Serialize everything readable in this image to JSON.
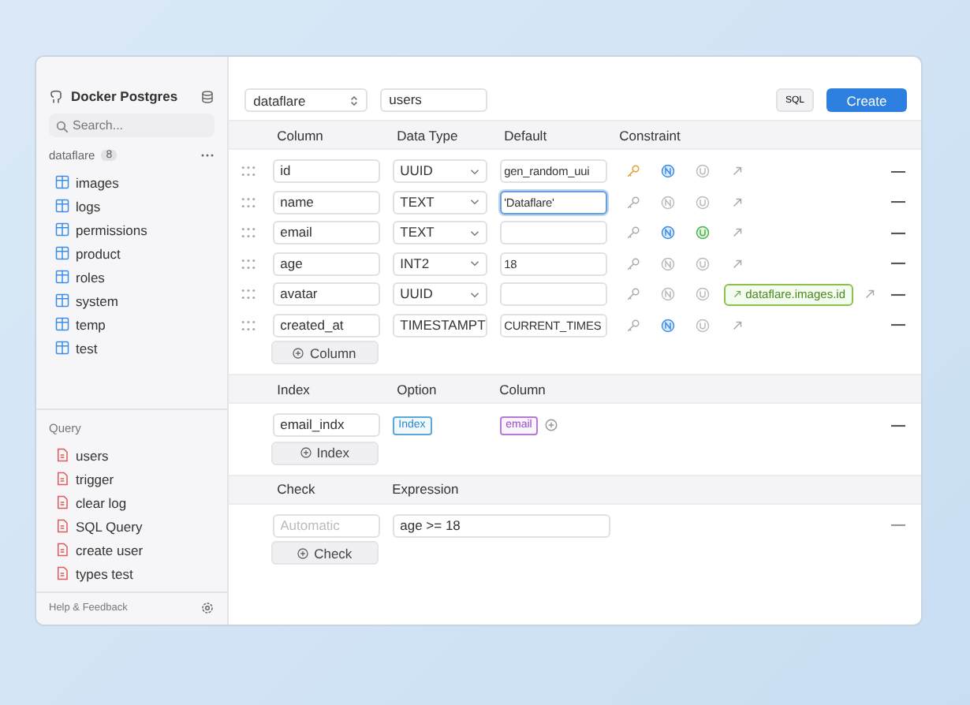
{
  "sidebar": {
    "connection": "Docker Postgres",
    "search": {
      "placeholder": "Search..."
    },
    "schema": {
      "name": "dataflare",
      "count": "8"
    },
    "tables": [
      "images",
      "logs",
      "permissions",
      "product",
      "roles",
      "system",
      "temp",
      "test"
    ],
    "query_title": "Query",
    "queries": [
      "users",
      "trigger",
      "clear log",
      "SQL Query",
      "create user",
      "types test"
    ],
    "footer": "Help & Feedback"
  },
  "toolbar": {
    "schema": "dataflare",
    "table": "users",
    "sql_button": "SQL",
    "create_button": "Create"
  },
  "columns_table": {
    "headers": [
      "Column",
      "Data Type",
      "Default",
      "Constraint"
    ],
    "rows": [
      {
        "column": "id",
        "type": "UUID",
        "default": "gen_random_uui",
        "focused": false,
        "primary_key": true,
        "not_null": true,
        "unique": false
      },
      {
        "column": "name",
        "type": "TEXT",
        "default": "'Dataflare'",
        "focused": true,
        "primary_key": false,
        "not_null": false,
        "unique": false
      },
      {
        "column": "email",
        "type": "TEXT",
        "default": "",
        "focused": false,
        "primary_key": false,
        "not_null": true,
        "unique": true
      },
      {
        "column": "age",
        "type": "INT2",
        "default": "18",
        "focused": false,
        "primary_key": false,
        "not_null": false,
        "unique": false
      },
      {
        "column": "avatar",
        "type": "UUID",
        "default": "",
        "focused": false,
        "primary_key": false,
        "not_null": false,
        "unique": false,
        "reference": "dataflare.images.id"
      },
      {
        "column": "created_at",
        "type": "TIMESTAMPT",
        "default": "CURRENT_TIMES",
        "focused": false,
        "primary_key": false,
        "not_null": true,
        "unique": false
      }
    ],
    "add_button": "Column"
  },
  "index_table": {
    "headers": [
      "Index",
      "Option",
      "Column"
    ],
    "rows": [
      {
        "name": "email_indx",
        "option": "Index",
        "column": "email"
      }
    ],
    "add_button": "Index"
  },
  "check_table": {
    "headers": [
      "Check",
      "Expression"
    ],
    "rows": [
      {
        "name": {
          "placeholder": "Automatic"
        },
        "expression": "age >= 18"
      }
    ],
    "add_button": "Check"
  }
}
